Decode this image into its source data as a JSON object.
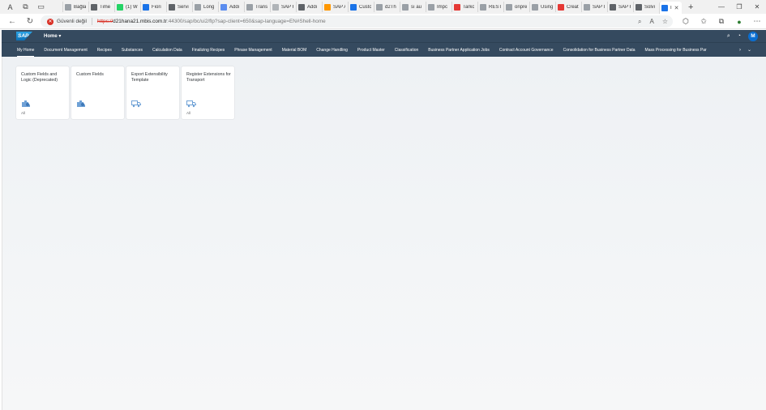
{
  "browser": {
    "tabs": [
      {
        "label": "Bağla",
        "color": "#9aa0a6"
      },
      {
        "label": "Time",
        "color": "#5f6368"
      },
      {
        "label": "(1) W",
        "color": "#25d366"
      },
      {
        "label": "Fiori",
        "color": "#1a73e8"
      },
      {
        "label": "Servi",
        "color": "#5f6368"
      },
      {
        "label": "Long",
        "color": "#9aa0a6"
      },
      {
        "label": "Addi",
        "color": "#5b8def"
      },
      {
        "label": "Trans",
        "color": "#9aa0a6"
      },
      {
        "label": "SAP F",
        "color": "#b0b4b8"
      },
      {
        "label": "Addi",
        "color": "#5f6368"
      },
      {
        "label": "SAP A",
        "color": "#ff9800"
      },
      {
        "label": "Custo",
        "color": "#1a73e8"
      },
      {
        "label": "d2Th",
        "color": "#9aa0a6"
      },
      {
        "label": "sı au",
        "color": "#9aa0a6"
      },
      {
        "label": "Impc",
        "color": "#9aa0a6"
      },
      {
        "label": "Tarkc",
        "color": "#e53935"
      },
      {
        "label": "REST",
        "color": "#9aa0a6"
      },
      {
        "label": "onpre",
        "color": "#9aa0a6"
      },
      {
        "label": "Using",
        "color": "#9aa0a6"
      },
      {
        "label": "Creat",
        "color": "#e53935"
      },
      {
        "label": "SAP I",
        "color": "#9aa0a6"
      },
      {
        "label": "SAP F",
        "color": "#5f6368"
      },
      {
        "label": "Solvi",
        "color": "#5f6368"
      },
      {
        "label": "I",
        "color": "#1a73e8"
      }
    ],
    "security_label": "Güvenli değil",
    "url_scheme": "https://",
    "url_host": "d21hana21.mbis.com.tr",
    "url_path": ":44300/sap/bc/ui2/flp?sap-client=650&sap-language=EN#Shell-home"
  },
  "shell": {
    "logo": "SAP",
    "title": "Home ▾",
    "avatar_initial": "M"
  },
  "spaces": [
    "My Home",
    "Document Management",
    "Recipes",
    "Substances",
    "Calculation Data",
    "Finalizing Recipes",
    "Phrase Management",
    "Material BOM",
    "Change Handling",
    "Product Master",
    "Classification",
    "Business Partner Application Jobs",
    "Contract Account Governance",
    "Consolidation for Business Partner Data",
    "Mass Processing for Business Par"
  ],
  "tiles": [
    {
      "title": "Custom Fields and Logic (Deprecated)",
      "footer": "All",
      "icon": "extension-icon"
    },
    {
      "title": "Custom Fields",
      "footer": "",
      "icon": "extension-icon"
    },
    {
      "title": "Export Extensibility Template",
      "footer": "",
      "icon": "transport-icon"
    },
    {
      "title": "Register Extensions for Transport",
      "footer": "All",
      "icon": "transport-icon"
    }
  ],
  "colors": {
    "shell_bg": "#354a5f",
    "content_bg": "#eef1f4",
    "accent": "#0a6ed1"
  }
}
